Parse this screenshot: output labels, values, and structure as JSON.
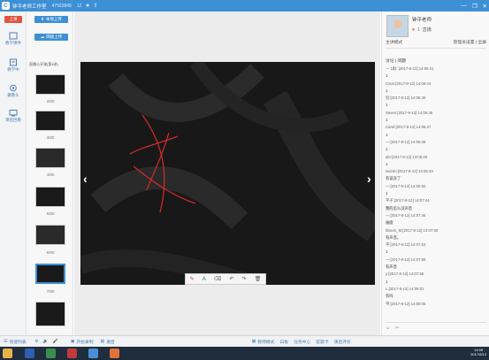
{
  "window": {
    "title": "钟平老师工作室",
    "meta": "47922849",
    "count": "12",
    "controls": [
      "—",
      "❐",
      "✕"
    ]
  },
  "leftbar": {
    "items": [
      {
        "label": "上课",
        "icon": "class-icon",
        "active": true
      },
      {
        "label": "教学课件",
        "icon": "courseware-icon"
      },
      {
        "label": "教学中",
        "icon": "teaching-icon"
      },
      {
        "label": "摄像头",
        "icon": "camera-icon"
      },
      {
        "label": "课后回看",
        "icon": "replay-icon"
      }
    ]
  },
  "thumbs": {
    "upload_local": "本地上传",
    "upload_net": "网盘上传",
    "file_name": "直播公开课(第4讲)",
    "labels": [
      "2/80",
      "3/80",
      "4/80",
      "5/80",
      "6/80",
      "7/80"
    ]
  },
  "canvas": {
    "toolbar": [
      "✎",
      "A",
      "⌫",
      "↶",
      "↷",
      "🗑"
    ]
  },
  "right": {
    "teacher_name": "钟平老师",
    "heart_count": "1",
    "status_label": "直播",
    "mode_label": "主讲模式",
    "mode_right": "管理员设置 | 全屏",
    "tabs_label": "讨论 | 问题",
    "chat": [
      {
        "text": "一 1群: [2017-8-12] 14:06:41",
        "hl": false
      },
      {
        "text": "1",
        "hl": true
      },
      {
        "text": "Caos:[2017-8-12] 14:06:44",
        "hl": false
      },
      {
        "text": "1",
        "hl": true
      },
      {
        "text": "恒:[2017-8-12] 14:06:45",
        "hl": false
      },
      {
        "text": "1",
        "hl": true
      },
      {
        "text": "Seven:[2017-8-12] 14:06:45",
        "hl": false
      },
      {
        "text": "1",
        "hl": true
      },
      {
        "text": "Carol:[2017-8-12] 14:06:47",
        "hl": false
      },
      {
        "text": "1",
        "hl": true
      },
      {
        "text": "一:[2017-8-12] 14:06:48",
        "hl": false
      },
      {
        "text": "1",
        "hl": true
      },
      {
        "text": "ybr:[2017-8-12] 14:06:48",
        "hl": false
      },
      {
        "text": "1",
        "hl": true
      },
      {
        "text": "weirdo:[2017-8-12] 14:06:49",
        "hl": false
      },
      {
        "text": "有误没了",
        "hl": true
      },
      {
        "text": "一:[2017-8-12] 14:06:50",
        "hl": false
      },
      {
        "text": "1",
        "hl": true
      },
      {
        "text": "平子:[2017-8-12] 14:07:44",
        "hl": false
      },
      {
        "text": "我的怎么没声音",
        "hl": true
      },
      {
        "text": "一:[2017-8-12] 14:07:46",
        "hl": false
      },
      {
        "text": "画面",
        "hl": true
      },
      {
        "text": "lilsoon_M:[2017-8-12] 14:07:50",
        "hl": false
      },
      {
        "text": "有声音。",
        "hl": true
      },
      {
        "text": "平:[2017-8-12] 14:07:53",
        "hl": false
      },
      {
        "text": "1",
        "hl": true
      },
      {
        "text": "一:[2017-8-12] 14:07:55",
        "hl": false
      },
      {
        "text": "有声音",
        "hl": true
      },
      {
        "text": "y:[2017-8-12] 14:07:56",
        "hl": false
      },
      {
        "text": "1",
        "hl": true
      },
      {
        "text": "L:[2017-8-12] 14:08:02",
        "hl": false
      },
      {
        "text": "有吗",
        "hl": true
      },
      {
        "text": "平:[2017-8-12] 14:08:05",
        "hl": false
      }
    ],
    "input_icons": [
      "☺",
      "✂"
    ]
  },
  "statusbar": {
    "left": "快速列表",
    "record": "开始录制",
    "volume": "语音",
    "right_items": [
      "教师模式",
      "白板",
      "任务中心",
      "答题卡",
      "课后评价"
    ]
  },
  "taskbar": {
    "time": "14:08",
    "date": "2017/8/12"
  }
}
